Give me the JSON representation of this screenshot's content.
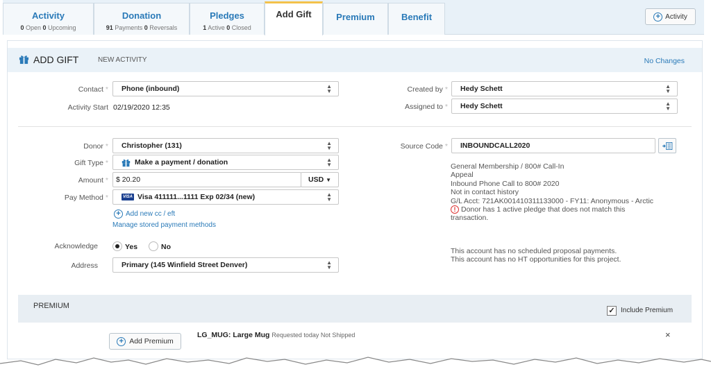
{
  "tabs": [
    {
      "title": "Activity",
      "sub": [
        {
          "n": "0",
          "t": " Open "
        },
        {
          "n": "0",
          "t": " Upcoming"
        }
      ]
    },
    {
      "title": "Donation",
      "sub": [
        {
          "n": "91",
          "t": " Payments "
        },
        {
          "n": "0",
          "t": " Reversals"
        }
      ]
    },
    {
      "title": "Pledges",
      "sub": [
        {
          "n": "1",
          "t": " Active "
        },
        {
          "n": "0",
          "t": " Closed"
        }
      ]
    },
    {
      "title": "Add Gift"
    },
    {
      "title": "Premium"
    },
    {
      "title": "Benefit"
    }
  ],
  "activity_button": "Activity",
  "header": {
    "title": "ADD GIFT",
    "subtitle": "NEW ACTIVITY",
    "status": "No Changes"
  },
  "form": {
    "contact": {
      "label": "Contact",
      "value": "Phone (inbound)"
    },
    "activity_start": {
      "label": "Activity Start",
      "value": "02/19/2020 12:35"
    },
    "created_by": {
      "label": "Created by",
      "value": "Hedy Schett"
    },
    "assigned_to": {
      "label": "Assigned to",
      "value": "Hedy Schett"
    },
    "donor": {
      "label": "Donor",
      "value": "Christopher (131)"
    },
    "gift_type": {
      "label": "Gift Type",
      "value": "Make a payment / donation"
    },
    "amount": {
      "label": "Amount",
      "value": "$ 20.20",
      "currency": "USD"
    },
    "pay_method": {
      "label": "Pay Method",
      "card_brand": "VISA",
      "value": "Visa 411111...1111 Exp 02/34 (new)"
    },
    "add_card_link": "Add new cc / eft",
    "manage_link": "Manage stored payment methods",
    "acknowledge": {
      "label": "Acknowledge",
      "yes": "Yes",
      "no": "No",
      "selected": "Yes"
    },
    "address": {
      "label": "Address",
      "value": "Primary (145 Winfield Street Denver)"
    },
    "source_code": {
      "label": "Source Code",
      "value": "INBOUNDCALL2020"
    }
  },
  "source_info": [
    "General Membership / 800# Call-In",
    "Appeal",
    "Inbound Phone Call to 800# 2020",
    "Not in contact history",
    "G/L Acct: 721AK001410311133000 - FY11: Anonymous - Arctic"
  ],
  "pledge_warning": [
    "Donor has 1 active pledge that does not match this",
    "transaction."
  ],
  "account_notes": [
    "This account has no scheduled proposal payments.",
    "This account has no HT opportunities for this project."
  ],
  "premium": {
    "title": "PREMIUM",
    "include_label": "Include Premium",
    "include_checked": true,
    "add_button": "Add Premium",
    "item_code": "LG_MUG: Large Mug",
    "item_status": "Requested today Not Shipped",
    "remove_glyph": "×"
  },
  "colors": {
    "accent": "#2a7ab8",
    "active_tab": "#f3c14a",
    "warning": "#dd3333"
  }
}
